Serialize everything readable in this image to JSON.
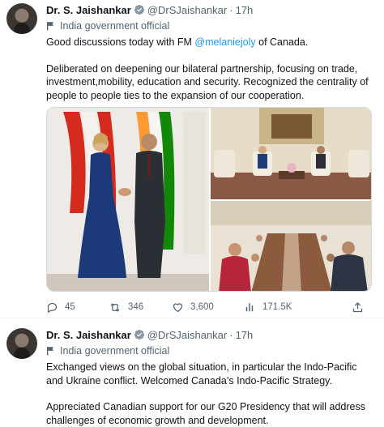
{
  "tweets": [
    {
      "author_name": "Dr. S. Jaishankar",
      "handle": "@DrSJaishankar",
      "separator": "·",
      "time": "17h",
      "affiliation": "India government official",
      "text_p1_before": "Good discussions today with FM ",
      "mention": "@melaniejoly",
      "text_p1_after": " of Canada.",
      "text_p2": "Deliberated on deepening our bilateral partnership, focusing on trade, investment,mobility, education and security. Recognized the centrality of people to people ties to the expansion of our cooperation.",
      "stats": {
        "replies": "45",
        "retweets": "346",
        "likes": "3,600",
        "views": "171.5K"
      }
    },
    {
      "author_name": "Dr. S. Jaishankar",
      "handle": "@DrSJaishankar",
      "separator": "·",
      "time": "17h",
      "affiliation": "India government official",
      "text_p1": "Exchanged views on the global situation, in particular the Indo-Pacific and Ukraine conflict. Welcomed Canada’s Indo-Pacific Strategy.",
      "text_p2": "Appreciated Canadian support for our G20 Presidency that will address challenges of economic growth and development."
    }
  ],
  "icons": {
    "verified": "verified-badge-icon",
    "affiliation": "flag-icon",
    "reply": "reply-icon",
    "retweet": "retweet-icon",
    "like": "heart-icon",
    "views": "views-chart-icon",
    "share": "share-icon"
  },
  "colors": {
    "accent": "#1d9bf0",
    "secondary_text": "#536471",
    "primary_text": "#0f1419"
  }
}
